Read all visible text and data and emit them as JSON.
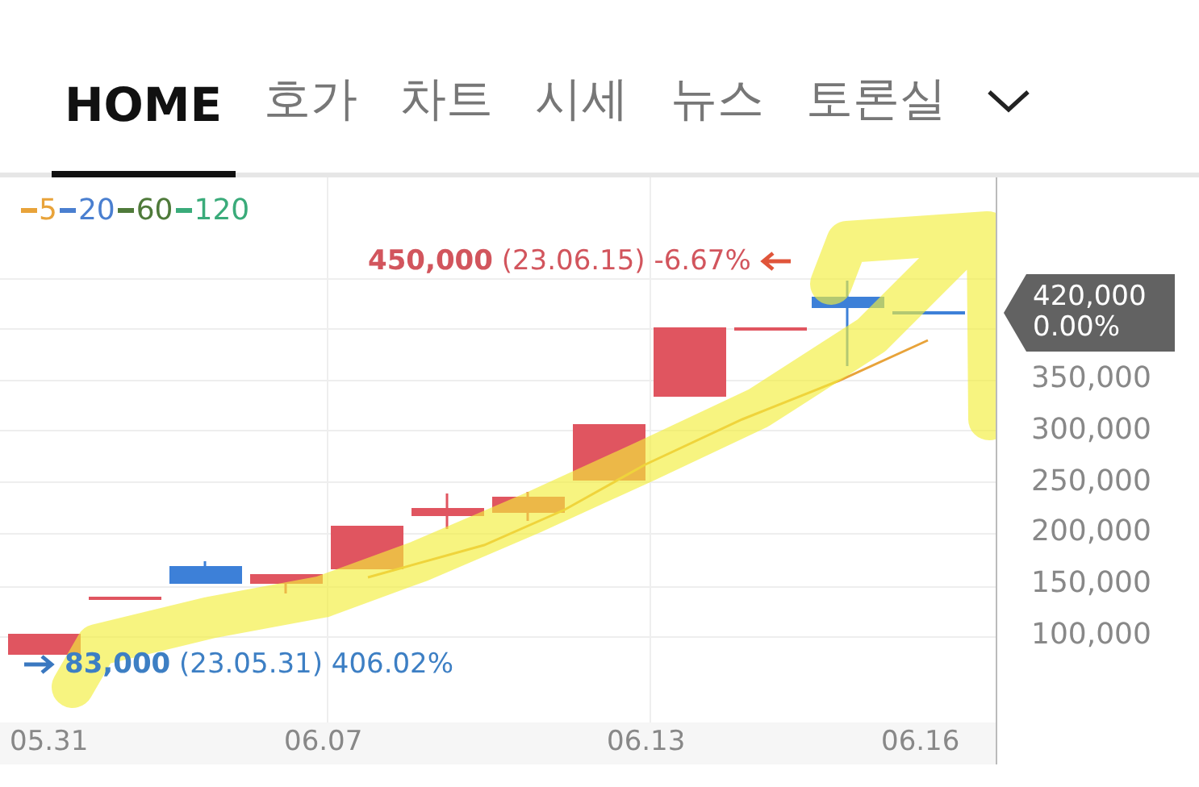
{
  "tabs": [
    {
      "label": "HOME",
      "selected": true
    },
    {
      "label": "호가",
      "selected": false
    },
    {
      "label": "차트",
      "selected": false
    },
    {
      "label": "시세",
      "selected": false
    },
    {
      "label": "뉴스",
      "selected": false
    },
    {
      "label": "토론실",
      "selected": false
    }
  ],
  "chart": {
    "ma_legend": [
      {
        "label": "5",
        "color": "#e8a33a"
      },
      {
        "label": "20",
        "color": "#4a7fd0"
      },
      {
        "label": "60",
        "color": "#4f7a3a"
      },
      {
        "label": "120",
        "color": "#3aab7a"
      }
    ],
    "high_marker": {
      "text": "**450,000** (23.06.15) -6.67%"
    },
    "low_marker": {
      "text": "**83,000** (23.05.31) 406.02%"
    },
    "current_price": {
      "price": "420,000",
      "change": "0.00%"
    },
    "y_axis_labels": [
      "350,000",
      "300,000",
      "250,000",
      "200,000",
      "150,000",
      "100,000"
    ],
    "x_axis_labels": [
      "05.31",
      "06.07",
      "06.13",
      "06.16"
    ]
  }
}
